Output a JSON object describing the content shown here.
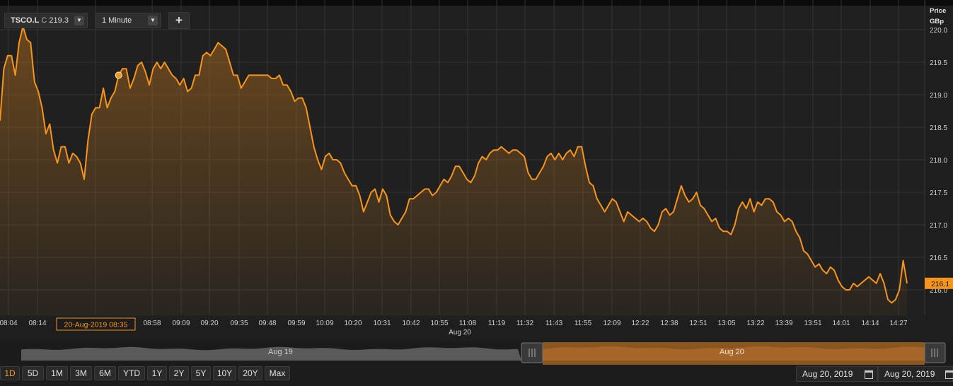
{
  "toolbar": {
    "symbol": "TSCO.L",
    "quote_label": "C",
    "quote_value": "219.3",
    "interval": "1 Minute",
    "add_label": "+"
  },
  "axis": {
    "y_title_line1": "Price",
    "y_title_line2": "GBp",
    "current_price_tag": "216.1",
    "crosshair_label": "20-Aug-2019 08:35",
    "date_label": "Aug 20"
  },
  "navigator": {
    "left_label": "Aug 19",
    "right_label": "Aug 20"
  },
  "timeframes": [
    "1D",
    "5D",
    "1M",
    "3M",
    "6M",
    "YTD",
    "1Y",
    "2Y",
    "5Y",
    "10Y",
    "20Y",
    "Max"
  ],
  "active_timeframe": "1D",
  "date_range": {
    "from": "Aug 20, 2019",
    "to": "Aug 20, 2019"
  },
  "colors": {
    "line": "#f7941d",
    "background": "#202020",
    "grid": "#333333"
  },
  "chart_data": {
    "type": "area",
    "title": "",
    "xlabel": "",
    "ylabel": "Price GBp",
    "ylim": [
      215.6,
      220.3
    ],
    "y_ticks": [
      216.0,
      216.5,
      217.0,
      217.5,
      218.0,
      218.5,
      219.0,
      219.5,
      220.0
    ],
    "x_ticks": [
      "08:04",
      "08:14",
      "08:35",
      "08:58",
      "09:09",
      "09:20",
      "09:35",
      "09:48",
      "09:59",
      "10:09",
      "10:20",
      "10:31",
      "10:42",
      "10:55",
      "11:08",
      "11:19",
      "11:32",
      "11:43",
      "11:55",
      "12:09",
      "12:22",
      "12:38",
      "12:51",
      "13:05",
      "13:22",
      "13:39",
      "13:51",
      "14:01",
      "14:14",
      "14:27"
    ],
    "grid": true,
    "series": [
      {
        "name": "TSCO.L",
        "values": [
          218.6,
          219.4,
          219.6,
          219.6,
          219.3,
          219.8,
          220.05,
          219.85,
          219.8,
          219.2,
          219.05,
          218.8,
          218.4,
          218.55,
          218.15,
          217.95,
          218.2,
          218.2,
          217.95,
          218.1,
          218.05,
          217.95,
          217.7,
          218.3,
          218.7,
          218.8,
          218.8,
          219.1,
          218.8,
          218.95,
          219.05,
          219.3,
          219.4,
          219.4,
          219.1,
          219.25,
          219.45,
          219.5,
          219.35,
          219.15,
          219.4,
          219.5,
          219.4,
          219.5,
          219.4,
          219.3,
          219.25,
          219.15,
          219.25,
          219.05,
          219.1,
          219.3,
          219.3,
          219.6,
          219.65,
          219.6,
          219.7,
          219.8,
          219.75,
          219.7,
          219.5,
          219.3,
          219.3,
          219.1,
          219.2,
          219.3,
          219.3,
          219.3,
          219.3,
          219.3,
          219.3,
          219.25,
          219.25,
          219.3,
          219.15,
          219.15,
          219.05,
          218.9,
          218.95,
          218.95,
          218.8,
          218.5,
          218.2,
          218.0,
          217.85,
          218.05,
          218.1,
          218.0,
          218.0,
          217.95,
          217.8,
          217.7,
          217.6,
          217.6,
          217.45,
          217.2,
          217.35,
          217.5,
          217.55,
          217.35,
          217.55,
          217.45,
          217.15,
          217.05,
          217.0,
          217.1,
          217.2,
          217.4,
          217.4,
          217.45,
          217.5,
          217.55,
          217.55,
          217.45,
          217.5,
          217.6,
          217.7,
          217.65,
          217.75,
          217.9,
          217.9,
          217.8,
          217.7,
          217.65,
          217.75,
          217.95,
          218.05,
          218.0,
          218.1,
          218.15,
          218.15,
          218.2,
          218.15,
          218.1,
          218.15,
          218.15,
          218.1,
          218.05,
          217.8,
          217.7,
          217.7,
          217.8,
          217.9,
          218.05,
          218.1,
          218.0,
          218.1,
          218.0,
          218.1,
          218.15,
          218.05,
          218.2,
          218.2,
          217.9,
          217.65,
          217.6,
          217.4,
          217.3,
          217.2,
          217.3,
          217.4,
          217.35,
          217.2,
          217.05,
          217.2,
          217.15,
          217.1,
          217.05,
          217.1,
          217.05,
          216.95,
          216.9,
          217.0,
          217.2,
          217.25,
          217.15,
          217.2,
          217.4,
          217.6,
          217.45,
          217.35,
          217.4,
          217.5,
          217.3,
          217.25,
          217.15,
          217.05,
          217.1,
          216.95,
          216.9,
          216.9,
          216.85,
          217.0,
          217.25,
          217.35,
          217.25,
          217.4,
          217.2,
          217.35,
          217.3,
          217.4,
          217.4,
          217.35,
          217.2,
          217.15,
          217.05,
          217.1,
          217.05,
          216.9,
          216.8,
          216.6,
          216.55,
          216.45,
          216.35,
          216.4,
          216.3,
          216.25,
          216.35,
          216.3,
          216.15,
          216.05,
          216.0,
          216.0,
          216.1,
          216.05,
          216.1,
          216.15,
          216.2,
          216.15,
          216.1,
          216.25,
          216.1,
          215.85,
          215.8,
          215.85,
          216.0,
          216.45,
          216.1
        ]
      }
    ]
  }
}
